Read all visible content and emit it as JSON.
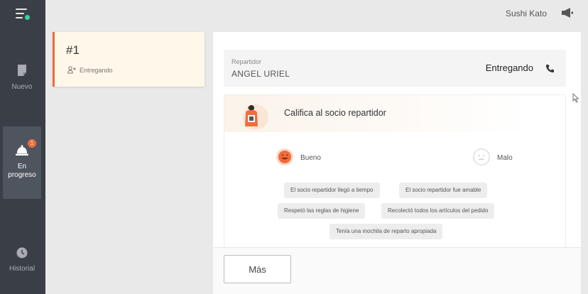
{
  "sidebar": {
    "items": [
      {
        "label": "Nuevo",
        "icon": "new-order-icon"
      },
      {
        "label": "En progreso",
        "icon": "bell-icon",
        "badge": "1"
      },
      {
        "label": "Historial",
        "icon": "clock-icon"
      }
    ]
  },
  "header": {
    "store_name": "Sushi Kato"
  },
  "order": {
    "number": "#1",
    "status": "Entregando"
  },
  "courier": {
    "label": "Repartidor",
    "name": "ANGEL URIEL",
    "status": "Entregando"
  },
  "rating": {
    "title": "Califica al socio repartidor",
    "good_label": "Bueno",
    "bad_label": "Malo",
    "chips": [
      "El socio repartidor llegó a tiempo",
      "El socio repartidor fue amable",
      "Respetó las reglas de higiene",
      "Recolectó todos los artículos del pedido",
      "Tenía una mochila de reparto apropiada"
    ]
  },
  "footer": {
    "more_label": "Más"
  },
  "colors": {
    "accent": "#f26b3a",
    "sidebar_bg": "#3a3f47",
    "active_item": "#4f555e",
    "menu_dot": "#3ecfa0"
  }
}
